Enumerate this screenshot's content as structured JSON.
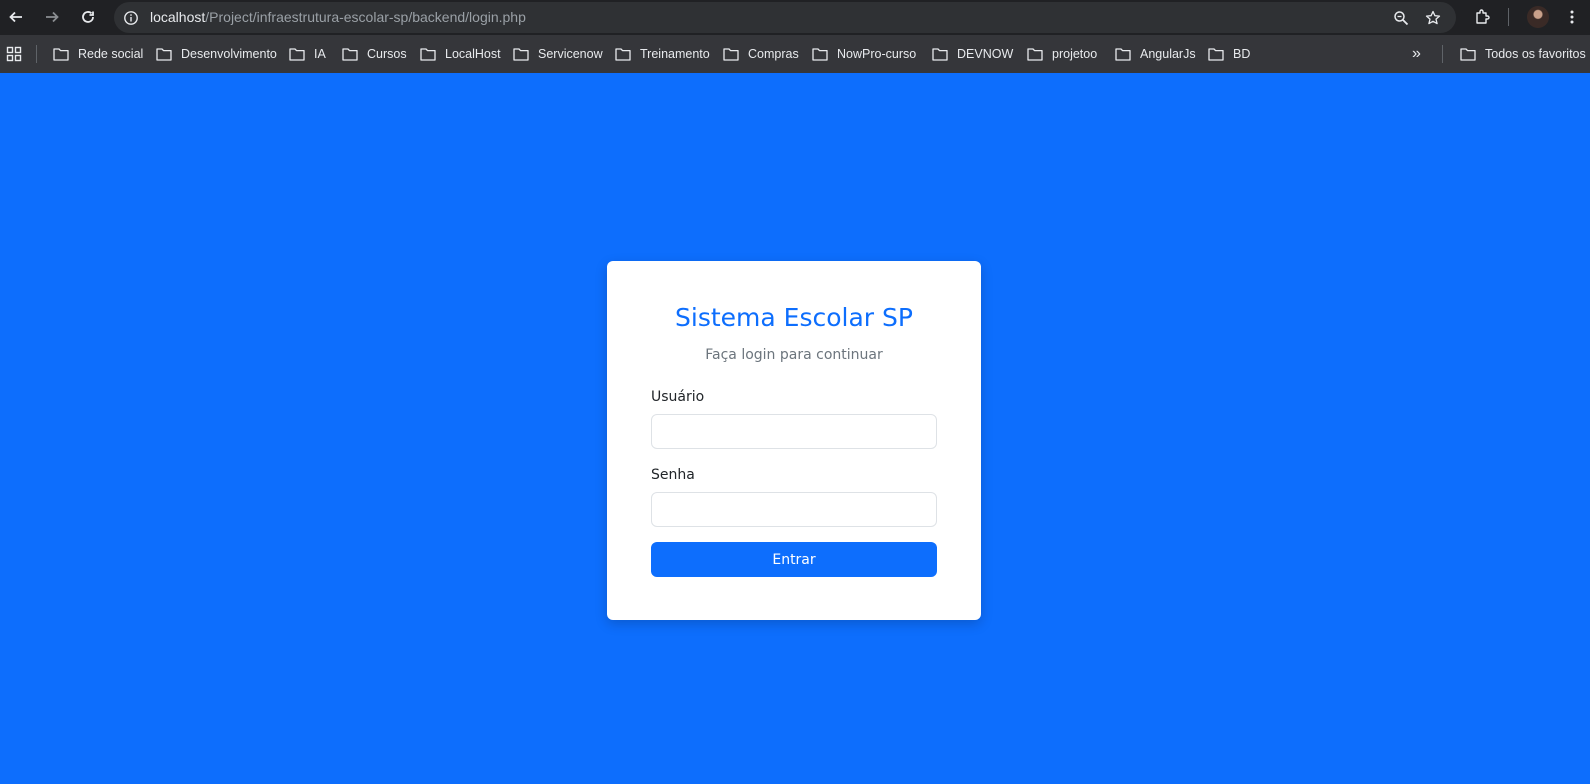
{
  "browser": {
    "url_host": "localhost",
    "url_path": "/Project/infraestrutura-escolar-sp/backend/login.php",
    "bookmarks": [
      "Rede social",
      "Desenvolvimento",
      "IA",
      "Cursos",
      "LocalHost",
      "Servicenow",
      "Treinamento",
      "Compras",
      "NowPro-curso",
      "DEVNOW",
      "projetoo",
      "AngularJs",
      "BD"
    ],
    "all_bookmarks_label": "Todos os favoritos",
    "overflow_label": "»"
  },
  "login": {
    "title": "Sistema Escolar SP",
    "subtitle": "Faça login para continuar",
    "username_label": "Usuário",
    "username_value": "",
    "password_label": "Senha",
    "password_value": "",
    "submit_label": "Entrar"
  },
  "colors": {
    "page_background": "#0d6efd",
    "accent": "#0d6efd",
    "card": "#ffffff"
  }
}
